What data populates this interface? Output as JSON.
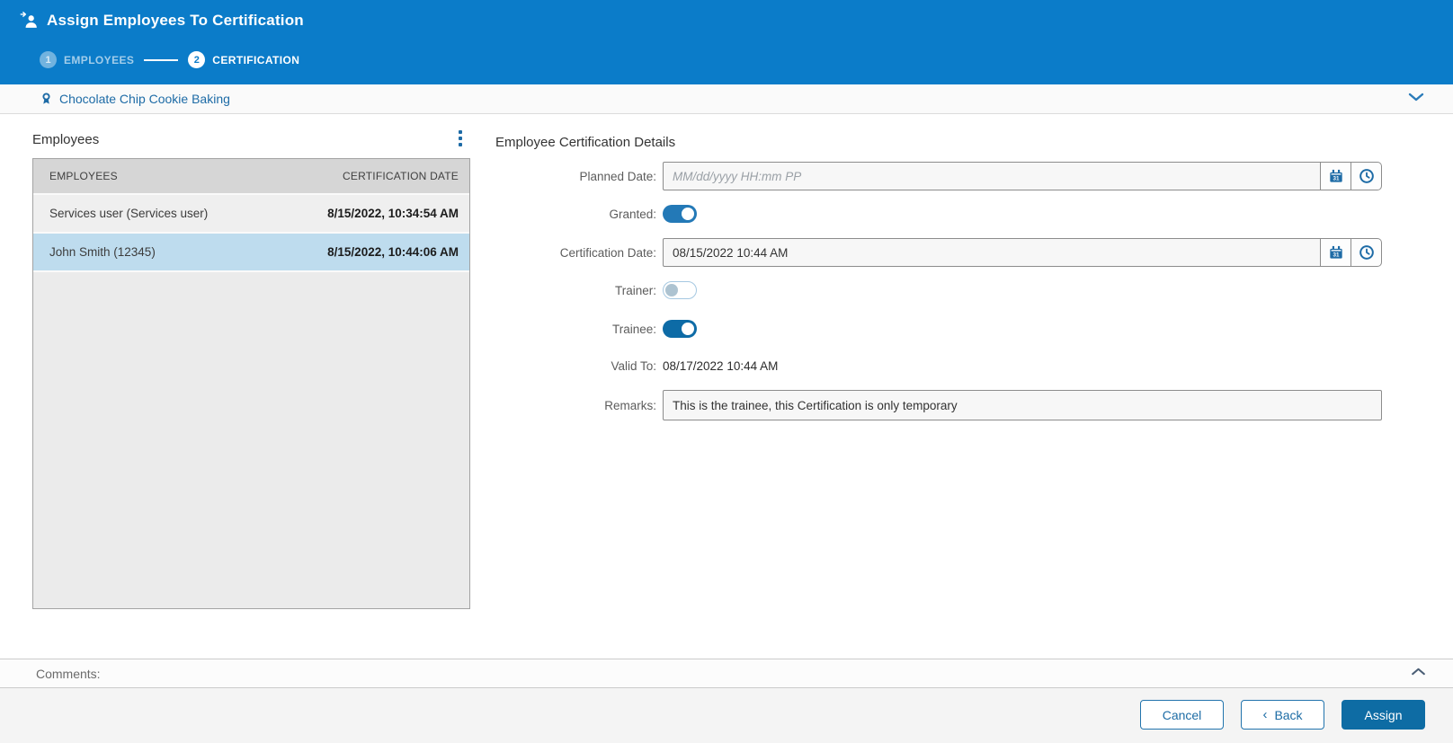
{
  "header": {
    "title": "Assign Employees To Certification",
    "steps": [
      {
        "number": "1",
        "label": "EMPLOYEES",
        "active": false
      },
      {
        "number": "2",
        "label": "CERTIFICATION",
        "active": true
      }
    ]
  },
  "certification_bar": {
    "name": "Chocolate Chip Cookie Baking"
  },
  "employees_panel": {
    "title": "Employees",
    "table": {
      "columns": {
        "employee": "EMPLOYEES",
        "certification_date": "CERTIFICATION DATE"
      },
      "rows": [
        {
          "employee": "Services user (Services user)",
          "certification_date": "8/15/2022, 10:34:54 AM",
          "selected": false
        },
        {
          "employee": "John Smith (12345)",
          "certification_date": "8/15/2022, 10:44:06 AM",
          "selected": true
        }
      ]
    }
  },
  "details_panel": {
    "title": "Employee Certification Details",
    "fields": {
      "planned_date": {
        "label": "Planned Date:",
        "value": "",
        "placeholder": "MM/dd/yyyy HH:mm PP"
      },
      "granted": {
        "label": "Granted:",
        "on": true
      },
      "certification_date": {
        "label": "Certification Date:",
        "value": "08/15/2022 10:44 AM"
      },
      "trainer": {
        "label": "Trainer:",
        "on": false
      },
      "trainee": {
        "label": "Trainee:",
        "on": true
      },
      "valid_to": {
        "label": "Valid To:",
        "value": "08/17/2022 10:44 AM"
      },
      "remarks": {
        "label": "Remarks:",
        "value": "This is the trainee, this Certification is only temporary"
      }
    },
    "calendar_icon_day": "31"
  },
  "comments_bar": {
    "label": "Comments:"
  },
  "footer": {
    "cancel_label": "Cancel",
    "back_chevron": "‹",
    "back_label": "Back",
    "assign_label": "Assign"
  },
  "colors": {
    "header_blue": "#0b7cc9",
    "accent_blue": "#1d6ba6",
    "primary_button_blue": "#0e6ca4",
    "toggle_on_blue": "#2379b7",
    "trainee_toggle_blue": "#0d6ba6",
    "selected_row_blue": "#bedcee",
    "table_header_gray": "#d6d6d6",
    "row_gray": "#efefef"
  }
}
